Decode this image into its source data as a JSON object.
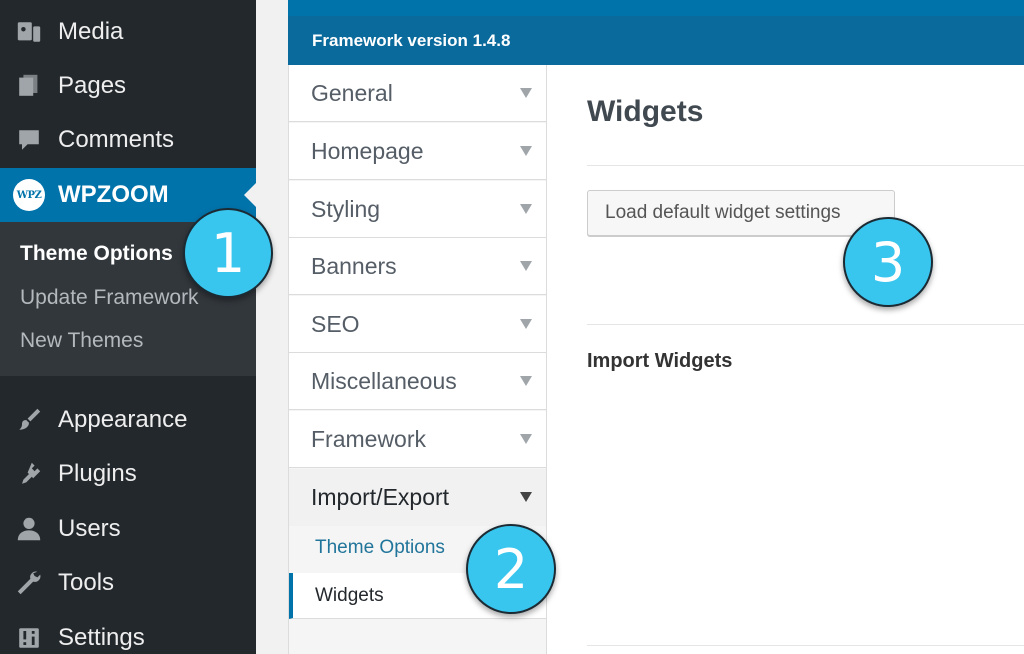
{
  "sidebar": {
    "items": [
      {
        "label": "Media",
        "icon": "media-icon"
      },
      {
        "label": "Pages",
        "icon": "pages-icon"
      },
      {
        "label": "Comments",
        "icon": "comments-icon"
      },
      {
        "label": "WPZOOM",
        "icon": "wpzoom-logo-icon",
        "logo_text": "WPZ"
      },
      {
        "label": "Appearance",
        "icon": "appearance-brush-icon"
      },
      {
        "label": "Plugins",
        "icon": "plugins-icon"
      },
      {
        "label": "Users",
        "icon": "users-icon"
      },
      {
        "label": "Tools",
        "icon": "tools-wrench-icon"
      },
      {
        "label": "Settings",
        "icon": "settings-sliders-icon"
      }
    ],
    "submenu": [
      {
        "label": "Theme Options"
      },
      {
        "label": "Update Framework"
      },
      {
        "label": "New Themes"
      }
    ]
  },
  "framework": {
    "version_label": "Framework version 1.4.8",
    "tabs": [
      {
        "label": "General"
      },
      {
        "label": "Homepage"
      },
      {
        "label": "Styling"
      },
      {
        "label": "Banners"
      },
      {
        "label": "SEO"
      },
      {
        "label": "Miscellaneous"
      },
      {
        "label": "Framework"
      },
      {
        "label": "Import/Export"
      }
    ],
    "subtabs": [
      {
        "label": "Theme Options"
      },
      {
        "label": "Widgets"
      }
    ]
  },
  "content": {
    "title": "Widgets",
    "load_button": "Load default widget settings",
    "import_heading": "Import Widgets"
  },
  "steps": [
    "1",
    "2",
    "3"
  ],
  "colors": {
    "sidebar_bg": "#23282d",
    "accent": "#0073aa",
    "step_marker": "#38c6ef"
  }
}
